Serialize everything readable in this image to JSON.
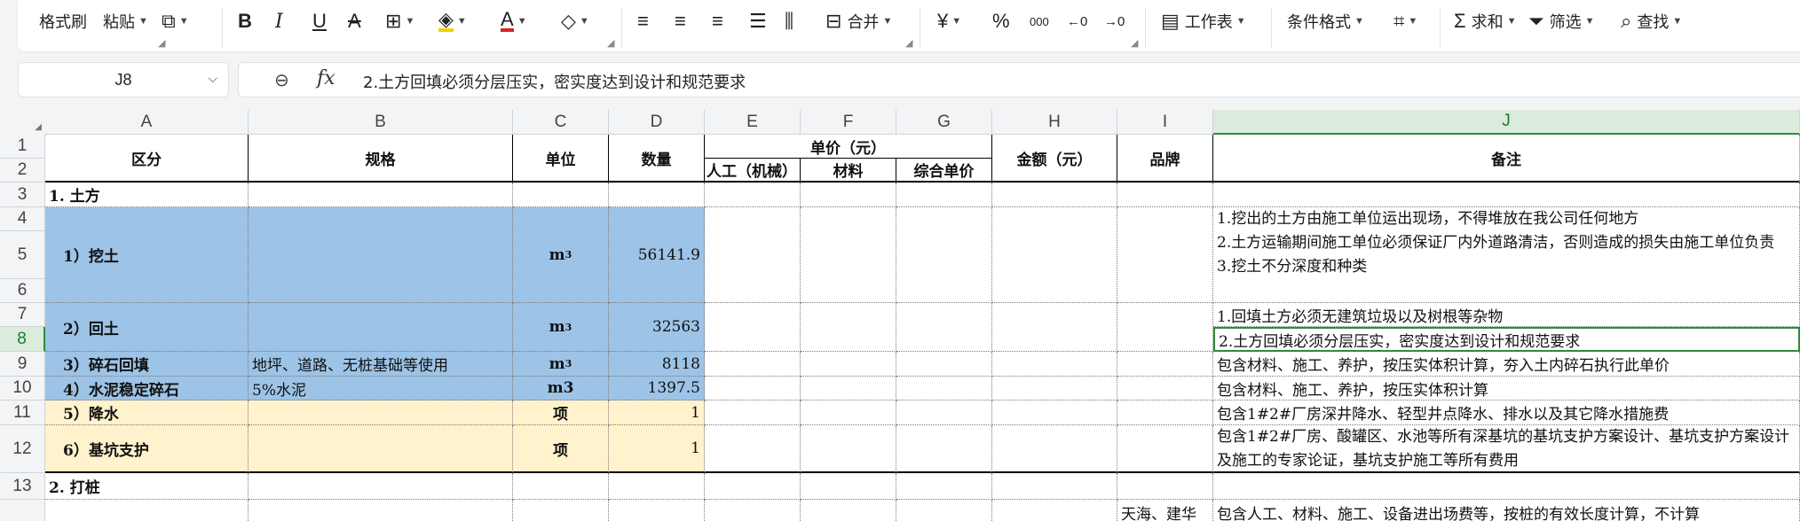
{
  "ribbon": {
    "format_painter": "格式刷",
    "paste": "粘贴",
    "merge": "合并",
    "currency": "¥",
    "percent": "%",
    "thousands": "000",
    "worksheet": "工作表",
    "conditional_format": "条件格式",
    "sum": "求和",
    "filter": "筛选",
    "find": "查找"
  },
  "formula_bar": {
    "name_box": "J8",
    "fx": "fx",
    "formula": "2.土方回填必须分层压实，密实度达到设计和规范要求"
  },
  "columns": [
    "A",
    "B",
    "C",
    "D",
    "E",
    "F",
    "G",
    "H",
    "I",
    "J"
  ],
  "rows": [
    "1",
    "2",
    "3",
    "4",
    "5",
    "6",
    "7",
    "8",
    "9",
    "10",
    "11",
    "12",
    "13"
  ],
  "header": {
    "region": "区分",
    "spec": "规格",
    "unit": "单位",
    "qty": "数量",
    "unit_price": "单价（元）",
    "labor": "人工（机械）",
    "material": "材料",
    "combined_price": "综合单价",
    "amount": "金额（元）",
    "brand": "品牌",
    "remarks": "备注"
  },
  "sections": {
    "earthwork": "1. 土方",
    "piling": "2. 打桩"
  },
  "items": [
    {
      "name": "1）挖土",
      "spec": "",
      "unit": "m",
      "unit_sup": "3",
      "qty": "56141.9"
    },
    {
      "name": "2）回土",
      "spec": "",
      "unit": "m",
      "unit_sup": "3",
      "qty": "32563"
    },
    {
      "name": "3）碎石回填",
      "spec": "地坪、道路、无桩基础等使用",
      "unit": "m",
      "unit_sup": "3",
      "qty": "8118"
    },
    {
      "name": "4）水泥稳定碎石",
      "spec": "5%水泥",
      "unit": "m3",
      "unit_sup": "",
      "qty": "1397.5"
    },
    {
      "name": "5）降水",
      "spec": "",
      "unit": "项",
      "unit_sup": "",
      "qty": "1"
    },
    {
      "name": "6）基坑支护",
      "spec": "",
      "unit": "项",
      "unit_sup": "",
      "qty": "1"
    }
  ],
  "notes": {
    "dig": [
      "1.挖出的土方由施工单位运出现场，不得堆放在我公司任何地方",
      "2.土方运输期间施工单位必须保证厂内外道路清洁，否则造成的损失由施工单位负责",
      "3.挖土不分深度和种类"
    ],
    "backfill_1": "1.回填土方必须无建筑垃圾以及树根等杂物",
    "backfill_2": "2.土方回填必须分层压实，密实度达到设计和规范要求",
    "gravel": "包含材料、施工、养护，按压实体积计算，夯入土内碎石执行此单价",
    "cement": "包含材料、施工、养护，按压实体积计算",
    "dewater": "包含1#2#厂房深井降水、轻型井点降水、排水以及其它降水措施费",
    "support": "包含1#2#厂房、酸罐区、水池等所有深基坑的基坑支护方案设计、基坑支护方案设计及施工的专家论证，基坑支护施工等所有费用",
    "piling_brand": "天海、建华",
    "piling_note": "包含人工、材料、施工、设备进出场费等，按桩的有效长度计算，不计算"
  }
}
